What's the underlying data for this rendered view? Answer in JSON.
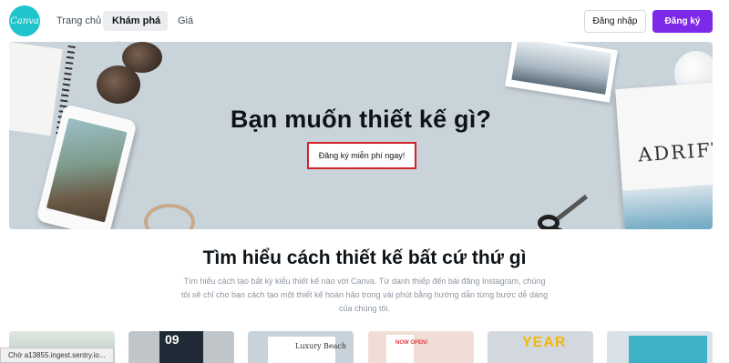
{
  "nav": {
    "logo_text": "Canva",
    "links": [
      "Trang chủ",
      "Khám phá",
      "Giá"
    ],
    "explore_chevron": "chevron-down-icon",
    "login_label": "Đăng nhập",
    "signup_label": "Đăng ký"
  },
  "hero": {
    "title": "Bạn muốn thiết kế gì?",
    "cta_label": "Đăng ký miễn phí ngay!",
    "magazine_title": "ADRIFT"
  },
  "section": {
    "title": "Tìm hiểu cách thiết kế bất cứ thứ gì",
    "description": "Tìm hiểu cách tạo bất kỳ kiểu thiết kế nào với Canva. Từ danh thiếp đến bài đăng Instagram, chúng tôi sẽ chỉ cho bạn cách tạo một thiết kế hoàn hảo trong vài phút bằng hướng dẫn từng bước dễ dàng của chúng tôi."
  },
  "cards": {
    "c2_text": "09",
    "c3_text": "Luxury Beach",
    "c4_text": "NOW OPEN!",
    "c5_text": "YEAR"
  },
  "status_bar": "Chờ a13855.ingest.sentry.io...",
  "colors": {
    "brand_logo": "#20c4cb",
    "signup_button": "#7d2ae8",
    "cta_highlight_border": "#d2232a"
  }
}
